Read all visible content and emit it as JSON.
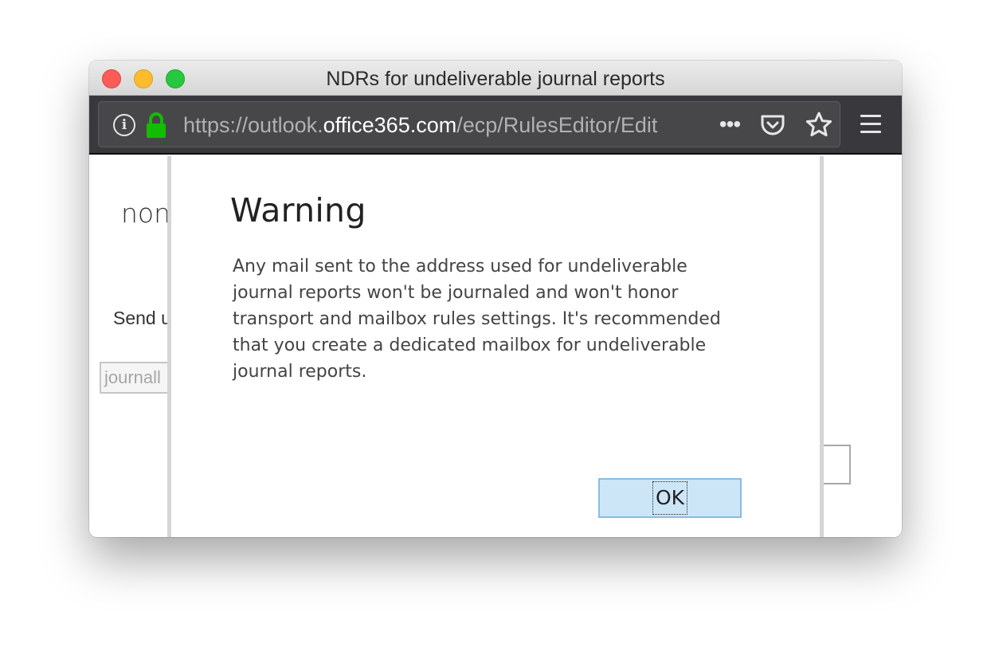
{
  "window": {
    "title": "NDRs for undeliverable journal reports",
    "controls": [
      "close",
      "minimize",
      "maximize"
    ]
  },
  "toolbar": {
    "url_prefix": "https://outlook.",
    "url_host": "office365.com",
    "url_path": "/ecp/RulesEditor/Edit",
    "page_actions_glyph": "•••",
    "icons": [
      "info-icon",
      "lock-icon",
      "page-actions-icon",
      "pocket-icon",
      "bookmark-star-icon",
      "hamburger-menu-icon"
    ]
  },
  "background": {
    "heading_fragment": "non",
    "label_fragment": "Send u",
    "input_fragment": "journall"
  },
  "dialog": {
    "title": "Warning",
    "message": "Any mail sent to the address used for undeliverable journal reports won't be journaled and won't honor transport and mailbox rules settings. It's recommended that you create a dedicated mailbox for undeliverable journal reports.",
    "ok_label": "OK"
  },
  "colors": {
    "toolbar_bg": "#38383d",
    "lock_green": "#12bc00",
    "ok_button_bg": "#cde6f7",
    "ok_button_border": "#87bde2"
  }
}
